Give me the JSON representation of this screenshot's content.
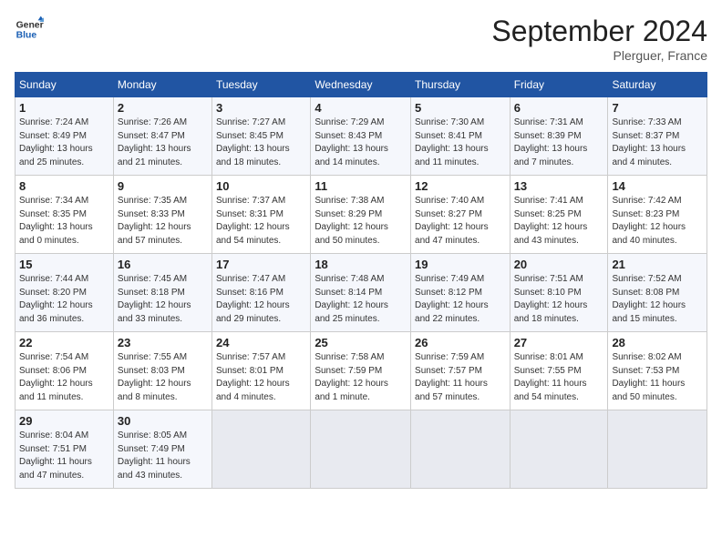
{
  "header": {
    "logo_general": "General",
    "logo_blue": "Blue",
    "month_title": "September 2024",
    "location": "Plerguer, France"
  },
  "days_of_week": [
    "Sunday",
    "Monday",
    "Tuesday",
    "Wednesday",
    "Thursday",
    "Friday",
    "Saturday"
  ],
  "weeks": [
    [
      {
        "day": "1",
        "info": "Sunrise: 7:24 AM\nSunset: 8:49 PM\nDaylight: 13 hours\nand 25 minutes."
      },
      {
        "day": "2",
        "info": "Sunrise: 7:26 AM\nSunset: 8:47 PM\nDaylight: 13 hours\nand 21 minutes."
      },
      {
        "day": "3",
        "info": "Sunrise: 7:27 AM\nSunset: 8:45 PM\nDaylight: 13 hours\nand 18 minutes."
      },
      {
        "day": "4",
        "info": "Sunrise: 7:29 AM\nSunset: 8:43 PM\nDaylight: 13 hours\nand 14 minutes."
      },
      {
        "day": "5",
        "info": "Sunrise: 7:30 AM\nSunset: 8:41 PM\nDaylight: 13 hours\nand 11 minutes."
      },
      {
        "day": "6",
        "info": "Sunrise: 7:31 AM\nSunset: 8:39 PM\nDaylight: 13 hours\nand 7 minutes."
      },
      {
        "day": "7",
        "info": "Sunrise: 7:33 AM\nSunset: 8:37 PM\nDaylight: 13 hours\nand 4 minutes."
      }
    ],
    [
      {
        "day": "8",
        "info": "Sunrise: 7:34 AM\nSunset: 8:35 PM\nDaylight: 13 hours\nand 0 minutes."
      },
      {
        "day": "9",
        "info": "Sunrise: 7:35 AM\nSunset: 8:33 PM\nDaylight: 12 hours\nand 57 minutes."
      },
      {
        "day": "10",
        "info": "Sunrise: 7:37 AM\nSunset: 8:31 PM\nDaylight: 12 hours\nand 54 minutes."
      },
      {
        "day": "11",
        "info": "Sunrise: 7:38 AM\nSunset: 8:29 PM\nDaylight: 12 hours\nand 50 minutes."
      },
      {
        "day": "12",
        "info": "Sunrise: 7:40 AM\nSunset: 8:27 PM\nDaylight: 12 hours\nand 47 minutes."
      },
      {
        "day": "13",
        "info": "Sunrise: 7:41 AM\nSunset: 8:25 PM\nDaylight: 12 hours\nand 43 minutes."
      },
      {
        "day": "14",
        "info": "Sunrise: 7:42 AM\nSunset: 8:23 PM\nDaylight: 12 hours\nand 40 minutes."
      }
    ],
    [
      {
        "day": "15",
        "info": "Sunrise: 7:44 AM\nSunset: 8:20 PM\nDaylight: 12 hours\nand 36 minutes."
      },
      {
        "day": "16",
        "info": "Sunrise: 7:45 AM\nSunset: 8:18 PM\nDaylight: 12 hours\nand 33 minutes."
      },
      {
        "day": "17",
        "info": "Sunrise: 7:47 AM\nSunset: 8:16 PM\nDaylight: 12 hours\nand 29 minutes."
      },
      {
        "day": "18",
        "info": "Sunrise: 7:48 AM\nSunset: 8:14 PM\nDaylight: 12 hours\nand 25 minutes."
      },
      {
        "day": "19",
        "info": "Sunrise: 7:49 AM\nSunset: 8:12 PM\nDaylight: 12 hours\nand 22 minutes."
      },
      {
        "day": "20",
        "info": "Sunrise: 7:51 AM\nSunset: 8:10 PM\nDaylight: 12 hours\nand 18 minutes."
      },
      {
        "day": "21",
        "info": "Sunrise: 7:52 AM\nSunset: 8:08 PM\nDaylight: 12 hours\nand 15 minutes."
      }
    ],
    [
      {
        "day": "22",
        "info": "Sunrise: 7:54 AM\nSunset: 8:06 PM\nDaylight: 12 hours\nand 11 minutes."
      },
      {
        "day": "23",
        "info": "Sunrise: 7:55 AM\nSunset: 8:03 PM\nDaylight: 12 hours\nand 8 minutes."
      },
      {
        "day": "24",
        "info": "Sunrise: 7:57 AM\nSunset: 8:01 PM\nDaylight: 12 hours\nand 4 minutes."
      },
      {
        "day": "25",
        "info": "Sunrise: 7:58 AM\nSunset: 7:59 PM\nDaylight: 12 hours\nand 1 minute."
      },
      {
        "day": "26",
        "info": "Sunrise: 7:59 AM\nSunset: 7:57 PM\nDaylight: 11 hours\nand 57 minutes."
      },
      {
        "day": "27",
        "info": "Sunrise: 8:01 AM\nSunset: 7:55 PM\nDaylight: 11 hours\nand 54 minutes."
      },
      {
        "day": "28",
        "info": "Sunrise: 8:02 AM\nSunset: 7:53 PM\nDaylight: 11 hours\nand 50 minutes."
      }
    ],
    [
      {
        "day": "29",
        "info": "Sunrise: 8:04 AM\nSunset: 7:51 PM\nDaylight: 11 hours\nand 47 minutes."
      },
      {
        "day": "30",
        "info": "Sunrise: 8:05 AM\nSunset: 7:49 PM\nDaylight: 11 hours\nand 43 minutes."
      },
      {
        "day": "",
        "info": ""
      },
      {
        "day": "",
        "info": ""
      },
      {
        "day": "",
        "info": ""
      },
      {
        "day": "",
        "info": ""
      },
      {
        "day": "",
        "info": ""
      }
    ]
  ]
}
